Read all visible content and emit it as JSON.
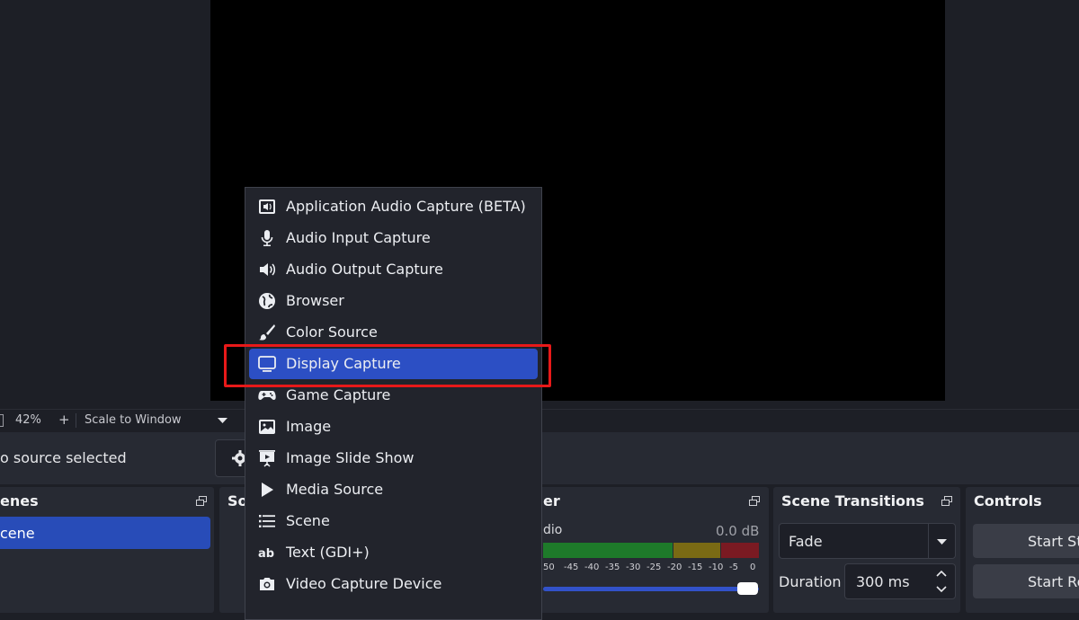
{
  "preview": {
    "bg": "#000000"
  },
  "statusbar": {
    "zoom": "42%",
    "plus": "+",
    "scale": "Scale to Window"
  },
  "properties_bar": {
    "no_source": "o source selected"
  },
  "docks": {
    "scenes": {
      "title": "enes",
      "item": "cene"
    },
    "sources": {
      "title": "So"
    },
    "audio_mixer": {
      "title": "er",
      "track": "dio",
      "level": "0.0 dB",
      "scale": [
        "50",
        "-45",
        "-40",
        "-35",
        "-30",
        "-25",
        "-20",
        "-15",
        "-10",
        "-5",
        "0"
      ],
      "volume": 1.0
    },
    "transitions": {
      "title": "Scene Transitions",
      "selected": "Fade",
      "duration_label": "Duration",
      "duration_value": "300 ms"
    },
    "controls": {
      "title": "Controls",
      "start_streaming": "Start Str",
      "start_recording": "Start Re"
    }
  },
  "menu": {
    "items": [
      {
        "label": "Application Audio Capture (BETA)",
        "icon": "app-audio-icon"
      },
      {
        "label": "Audio Input Capture",
        "icon": "microphone-icon"
      },
      {
        "label": "Audio Output Capture",
        "icon": "speaker-icon"
      },
      {
        "label": "Browser",
        "icon": "globe-icon"
      },
      {
        "label": "Color Source",
        "icon": "brush-icon"
      },
      {
        "label": "Display Capture",
        "icon": "monitor-icon"
      },
      {
        "label": "Game Capture",
        "icon": "gamepad-icon"
      },
      {
        "label": "Image",
        "icon": "image-icon"
      },
      {
        "label": "Image Slide Show",
        "icon": "slideshow-icon"
      },
      {
        "label": "Media Source",
        "icon": "play-icon"
      },
      {
        "label": "Scene",
        "icon": "list-icon"
      },
      {
        "label": "Text (GDI+)",
        "icon": "text-icon"
      },
      {
        "label": "Video Capture Device",
        "icon": "camera-icon"
      }
    ],
    "selected_index": 5
  },
  "colors": {
    "accent": "#2c4fc4",
    "highlight_box": "#e81919",
    "panel": "#272a33"
  }
}
